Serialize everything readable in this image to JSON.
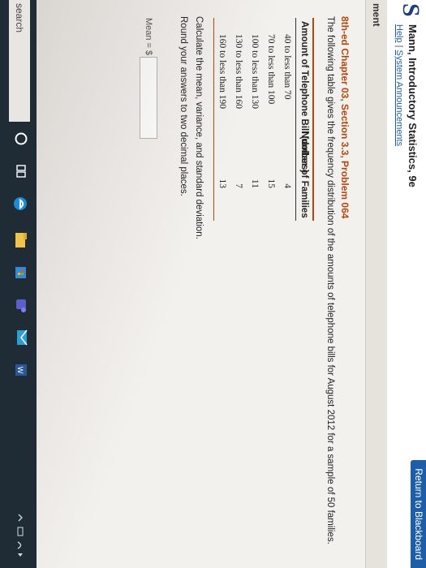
{
  "header": {
    "course_title": "Mann, Introductory Statistics, 9e",
    "help_link": "Help",
    "system_announcements_link": "System Announcements",
    "return_button": "Return to Blackboard"
  },
  "assignment_bar": {
    "label": "ment"
  },
  "problem": {
    "title": "8th-ed Chapter 03, Section 3.3, Problem 064",
    "description": "The following table gives the frequency distribution of the amounts of telephone bills for August 2012 for a sample of 50 families."
  },
  "table": {
    "headers": [
      "Amount of Telephone Bill (dollars)",
      "Number of Families"
    ],
    "rows": [
      {
        "amount": "40 to less than 70",
        "families": "4"
      },
      {
        "amount": "70 to less than 100",
        "families": "15"
      },
      {
        "amount": "100 to less than 130",
        "families": "11"
      },
      {
        "amount": "130 to less than 160",
        "families": "7"
      },
      {
        "amount": "160 to less than 190",
        "families": "13"
      }
    ]
  },
  "instructions": {
    "line1": "Calculate the mean, variance, and standard deviation.",
    "line2": "Round your answers to two decimal places."
  },
  "mean_field": {
    "label": "Mean = $",
    "value": ""
  },
  "taskbar": {
    "search_text": "search",
    "icons": [
      "cortana-icon",
      "task-view-icon",
      "edge-icon",
      "file-explorer-icon",
      "store-icon",
      "teams-icon",
      "mail-icon",
      "word-icon"
    ]
  },
  "colors": {
    "brand_blue": "#1e5ea8",
    "problem_orange": "#b2480f",
    "taskbar": "#1f2b35"
  }
}
